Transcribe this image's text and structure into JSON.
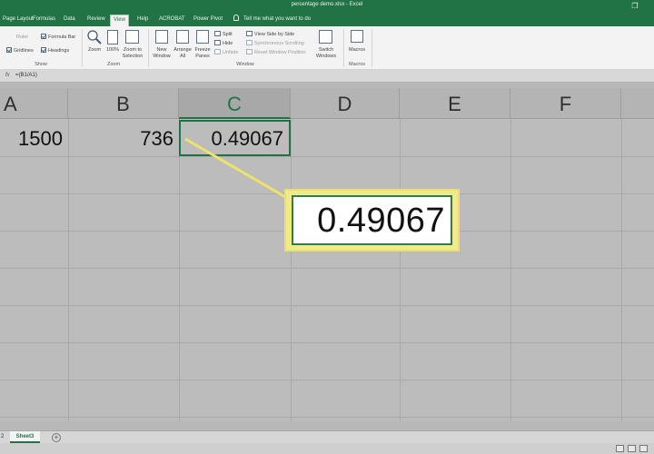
{
  "window": {
    "title": "percentage demo.xlsx  -  Excel",
    "restore_icon": "❐"
  },
  "tabs": [
    {
      "label": "Page Layout"
    },
    {
      "label": "Formulas"
    },
    {
      "label": "Data"
    },
    {
      "label": "Review"
    },
    {
      "label": "View",
      "active": true
    },
    {
      "label": "Help"
    },
    {
      "label": "ACROBAT"
    },
    {
      "label": "Power Pivot"
    }
  ],
  "tell_me": "Tell me what you want to do",
  "ribbon": {
    "show_group": {
      "ruler": "Ruler",
      "formula_bar": "Formula Bar",
      "gridlines": "Gridlines",
      "headings": "Headings",
      "label": "Show"
    },
    "zoom_group": {
      "zoom": "Zoom",
      "hundred": "100%",
      "zoom_to_selection": [
        "Zoom to",
        "Selection"
      ],
      "label": "Zoom"
    },
    "window_group": {
      "new_window": [
        "New",
        "Window"
      ],
      "arrange_all": [
        "Arrange",
        "All"
      ],
      "freeze_panes": [
        "Freeze",
        "Panes"
      ],
      "split": "Split",
      "hide": "Hide",
      "unhide": "Unhide",
      "view_side_by_side": "View Side by Side",
      "sync_scrolling": "Synchronous Scrolling",
      "reset_position": "Reset Window Position",
      "switch_windows": [
        "Switch",
        "Windows"
      ],
      "label": "Window"
    },
    "macros_group": {
      "macros": "Macros",
      "label": "Macros"
    }
  },
  "formula_bar": {
    "fx": "fx",
    "formula": "=(B1/A1)"
  },
  "columns": [
    "A",
    "B",
    "C",
    "D",
    "E",
    "F"
  ],
  "selected_column": "C",
  "cells": {
    "A1": "1500",
    "B1": "736",
    "C1": "0.49067"
  },
  "callout": {
    "value": "0.49067"
  },
  "sheets": {
    "prefix": "2",
    "active": "Sheet3",
    "add_icon": "+"
  },
  "colors": {
    "excel_green": "#217346",
    "callout_yellow": "#f0ea8a"
  }
}
